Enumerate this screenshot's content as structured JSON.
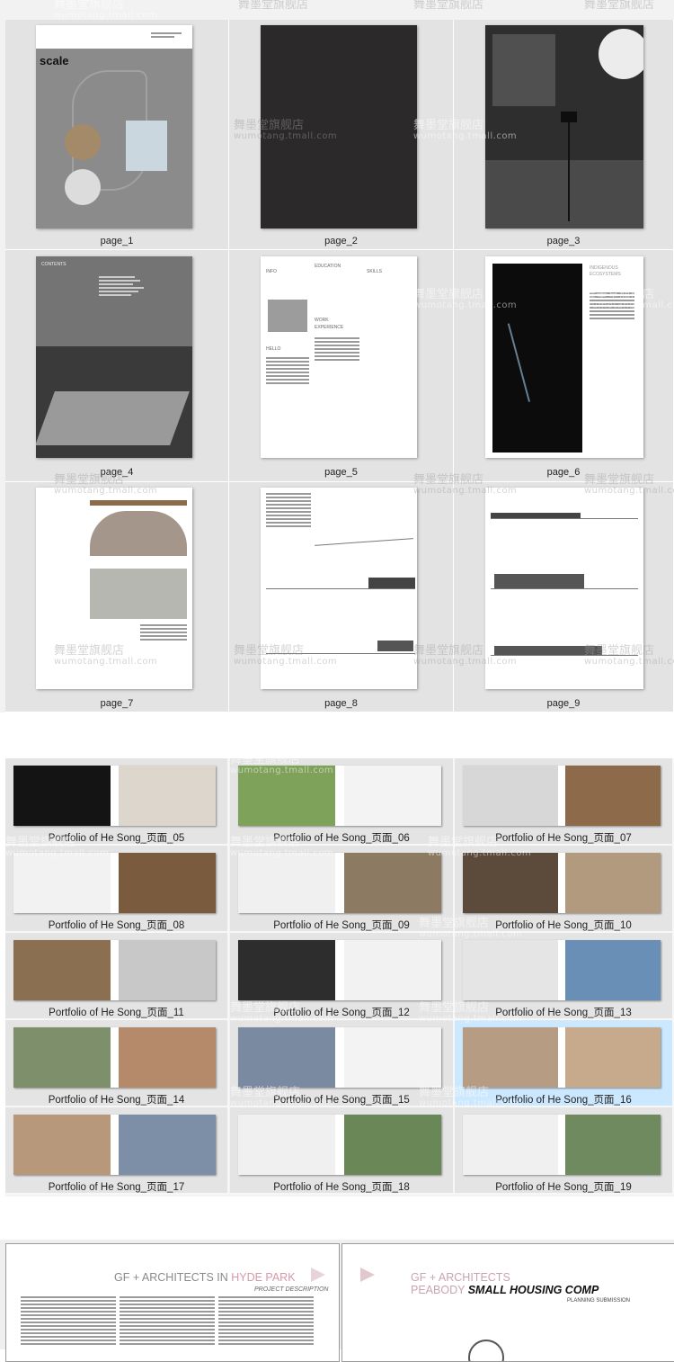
{
  "watermark": {
    "cn": "舞墨堂旗舰店",
    "en": "wumotang.tmall.com"
  },
  "pages": [
    {
      "label": "page_1"
    },
    {
      "label": "page_2"
    },
    {
      "label": "page_3"
    },
    {
      "label": "page_4"
    },
    {
      "label": "page_5"
    },
    {
      "label": "page_6"
    },
    {
      "label": "page_7"
    },
    {
      "label": "page_8"
    },
    {
      "label": "page_9"
    }
  ],
  "page1": {
    "title": "scale"
  },
  "page4": {
    "contents": "CONTENTS"
  },
  "page5": {
    "info": "INFO",
    "education": "EDUCATION",
    "skills": "SKILLS",
    "work": "WORK",
    "experience": "EXPERIENCE",
    "hello": "HELLO"
  },
  "page6": {
    "title": "INDIGENOUS",
    "subtitle": "ECOSYSTEMS"
  },
  "thumbnails": [
    {
      "label": "Portfolio of He Song_页面_05"
    },
    {
      "label": "Portfolio of He Song_页面_06"
    },
    {
      "label": "Portfolio of He Song_页面_07"
    },
    {
      "label": "Portfolio of He Song_页面_08"
    },
    {
      "label": "Portfolio of He Song_页面_09"
    },
    {
      "label": "Portfolio of He Song_页面_10"
    },
    {
      "label": "Portfolio of He Song_页面_11"
    },
    {
      "label": "Portfolio of He Song_页面_12"
    },
    {
      "label": "Portfolio of He Song_页面_13"
    },
    {
      "label": "Portfolio of He Song_页面_14"
    },
    {
      "label": "Portfolio of He Song_页面_15"
    },
    {
      "label": "Portfolio of He Song_页面_16",
      "selected": true
    },
    {
      "label": "Portfolio of He Song_页面_17"
    },
    {
      "label": "Portfolio of He Song_页面_18"
    },
    {
      "label": "Portfolio of He Song_页面_19"
    }
  ],
  "bottom": {
    "left_title_a": "GF + ARCHITECTS IN ",
    "left_title_b": "HYDE PARK",
    "left_subtitle": "PROJECT DESCRIPTION",
    "right_title_1": "GF + ARCHITECTS",
    "right_title_2a": "PEABODY ",
    "right_title_2b": "SMALL HOUSING COMP",
    "right_subtitle": "PLANNING SUBMISSION"
  },
  "colors": {
    "background": "#f2f2f2",
    "cell": "#e3e3e3",
    "selected": "#cce8ff",
    "accent_pink": "#d9a0ad"
  }
}
